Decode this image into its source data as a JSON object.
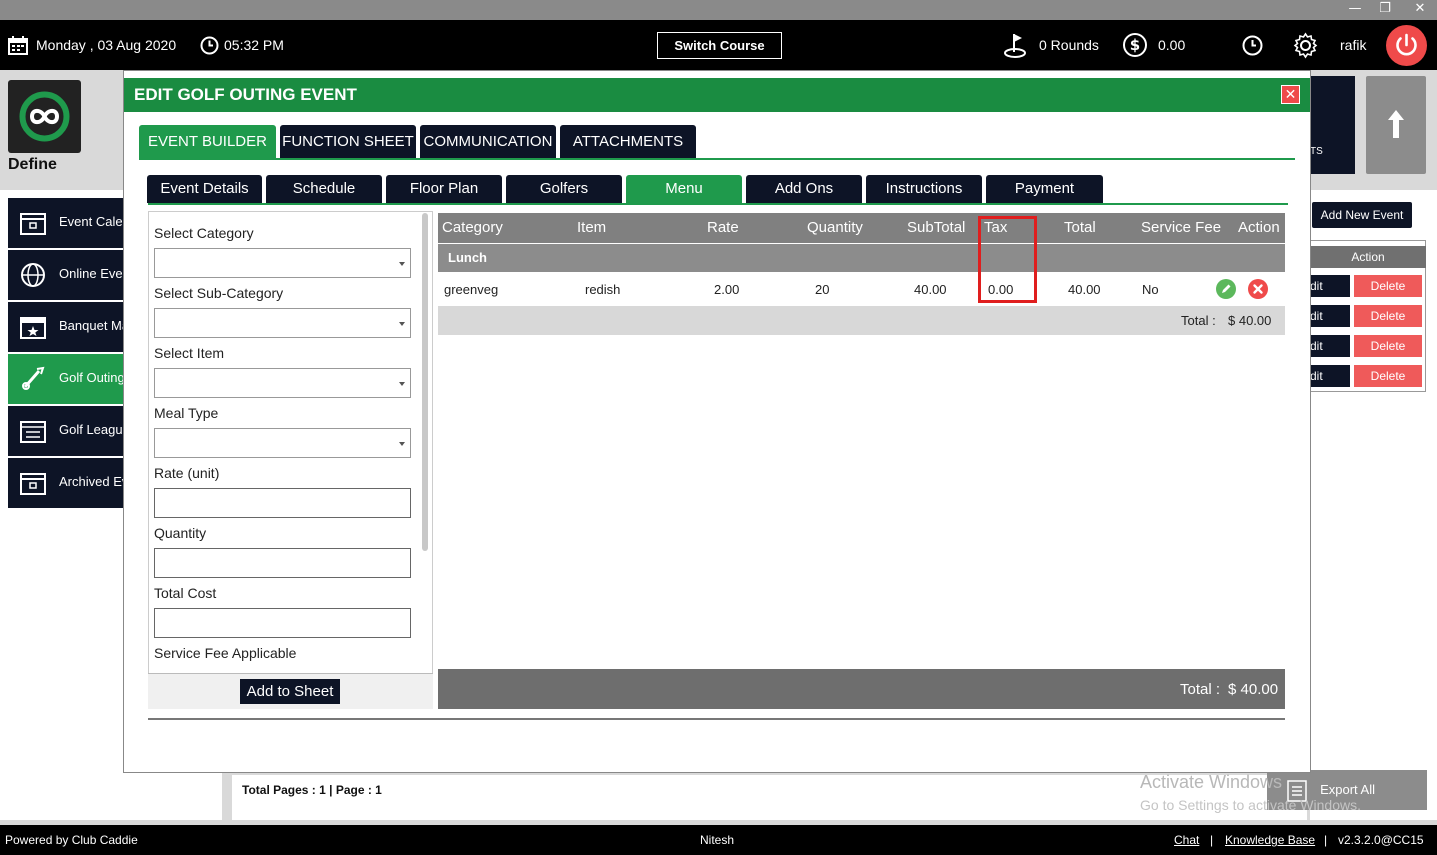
{
  "topbar": {
    "date": "Monday ,  03 Aug 2020",
    "time": "05:32 PM",
    "switch_course": "Switch Course",
    "rounds": "0 Rounds",
    "amount": "0.00",
    "user": "rafik"
  },
  "app": {
    "module_label": "Define"
  },
  "sidebar": {
    "items": [
      {
        "label": "Event Calendar"
      },
      {
        "label": "Online Events"
      },
      {
        "label": "Banquet Management"
      },
      {
        "label": "Golf Outing"
      },
      {
        "label": "Golf League"
      },
      {
        "label": "Archived Events"
      }
    ]
  },
  "right_panel": {
    "add_new": "Add New Event",
    "action_header": "Action",
    "edit_label": "dit",
    "delete_label": "Delete",
    "partial_text": "TS",
    "export_all": "Export All"
  },
  "list_footer": {
    "pages": "Total Pages : 1 | Page : 1"
  },
  "watermark": {
    "line1": "Activate Windows",
    "line2": "Go to Settings to activate Windows."
  },
  "footer": {
    "powered": "Powered by Club Caddie",
    "user": "Nitesh",
    "chat": "Chat",
    "sep1": "|",
    "kb": "Knowledge Base",
    "sep2": "|",
    "version": "v2.3.2.0@CC15"
  },
  "modal": {
    "title": "EDIT GOLF OUTING EVENT",
    "close": "✕",
    "tabs": [
      "EVENT BUILDER",
      "FUNCTION SHEET",
      "COMMUNICATION",
      "ATTACHMENTS"
    ],
    "subtabs": [
      "Event Details",
      "Schedule",
      "Floor Plan",
      "Golfers",
      "Menu",
      "Add Ons",
      "Instructions",
      "Payment"
    ],
    "form": {
      "category_label": "Select Category",
      "subcategory_label": "Select Sub-Category",
      "item_label": "Select Item",
      "meal_label": "Meal Type",
      "rate_label": "Rate (unit)",
      "quantity_label": "Quantity",
      "total_cost_label": "Total Cost",
      "service_fee_label": "Service Fee Applicable",
      "add_button": "Add to Sheet"
    },
    "grid": {
      "headers": [
        "Category",
        "Item",
        "Rate",
        "Quantity",
        "SubTotal",
        "Tax",
        "Total",
        "Service Fee",
        "Action"
      ],
      "group": "Lunch",
      "row": {
        "category": "greenveg",
        "item": "redish",
        "rate": "2.00",
        "quantity": "20",
        "subtotal": "40.00",
        "tax": "0.00",
        "total": "40.00",
        "service_fee": "No"
      },
      "group_total_label": "Total :",
      "group_total_value": "$ 40.00",
      "grand_total_label": "Total :",
      "grand_total_value": "$ 40.00"
    }
  }
}
